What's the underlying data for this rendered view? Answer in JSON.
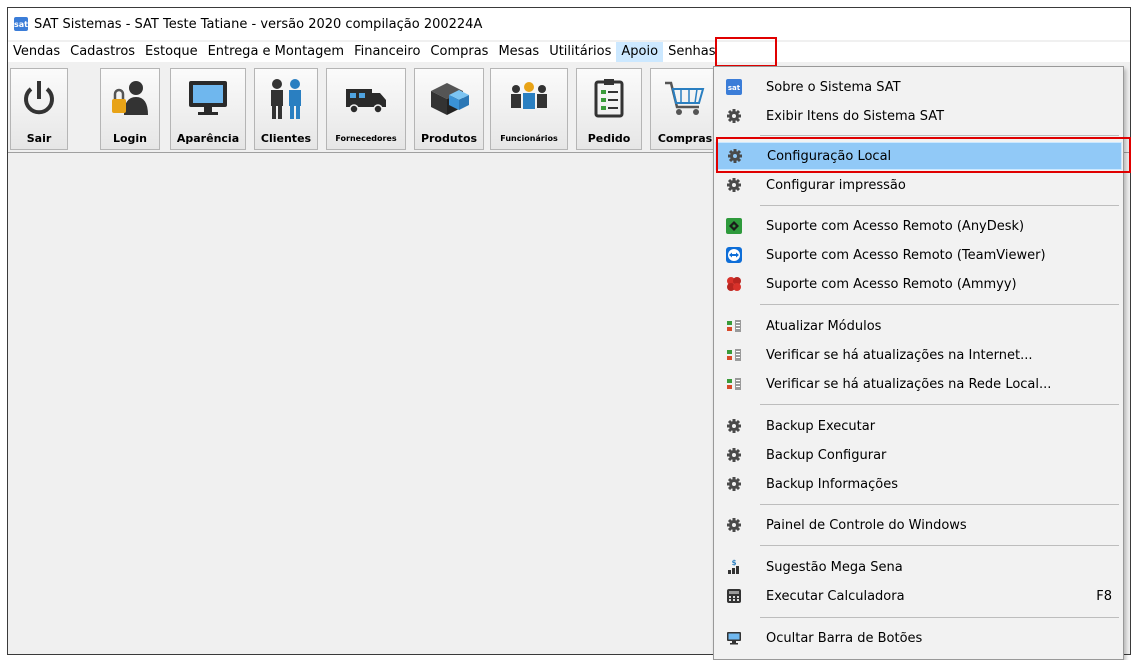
{
  "window": {
    "title": "SAT Sistemas - SAT Teste Tatiane - versão 2020 compilação 200224A",
    "app_icon_text": "sat"
  },
  "menubar": {
    "items": [
      {
        "label": "Vendas"
      },
      {
        "label": "Cadastros"
      },
      {
        "label": "Estoque"
      },
      {
        "label": "Entrega e Montagem"
      },
      {
        "label": "Financeiro"
      },
      {
        "label": "Compras"
      },
      {
        "label": "Mesas"
      },
      {
        "label": "Utilitários"
      },
      {
        "label": "Apoio",
        "active": true
      },
      {
        "label": "Senhas"
      }
    ]
  },
  "toolbar": {
    "buttons": [
      {
        "label": "Sair",
        "icon": "power-icon"
      },
      {
        "label": "Login",
        "icon": "user-lock-icon"
      },
      {
        "label": "Aparência",
        "icon": "monitor-icon"
      },
      {
        "label": "Clientes",
        "icon": "people-icon"
      },
      {
        "label": "Fornecedores",
        "icon": "truck-icon"
      },
      {
        "label": "Produtos",
        "icon": "boxes-icon"
      },
      {
        "label": "Funcionários",
        "icon": "team-icon"
      },
      {
        "label": "Pedido",
        "icon": "checklist-icon"
      },
      {
        "label": "Compras",
        "icon": "cart-icon"
      }
    ]
  },
  "apoio_menu": {
    "items": [
      {
        "label": "Sobre o Sistema SAT",
        "icon": "sat-logo-icon"
      },
      {
        "label": "Exibir Itens do Sistema SAT",
        "icon": "gear-icon"
      },
      {
        "label": "Configuração Local",
        "icon": "gear-icon",
        "selected": true
      },
      {
        "label": "Configurar impressão",
        "icon": "gear-icon"
      },
      {
        "label": "Suporte com Acesso Remoto (AnyDesk)",
        "icon": "anydesk-icon"
      },
      {
        "label": "Suporte com Acesso Remoto (TeamViewer)",
        "icon": "teamviewer-icon"
      },
      {
        "label": "Suporte com Acesso Remoto (Ammyy)",
        "icon": "ammyy-icon"
      },
      {
        "label": "Atualizar Módulos",
        "icon": "update-icon"
      },
      {
        "label": "Verificar se há atualizações na Internet...",
        "icon": "update-icon"
      },
      {
        "label": "Verificar se há atualizações na Rede Local...",
        "icon": "update-icon"
      },
      {
        "label": "Backup Executar",
        "icon": "gear-icon"
      },
      {
        "label": "Backup Configurar",
        "icon": "gear-icon"
      },
      {
        "label": "Backup Informações",
        "icon": "gear-icon"
      },
      {
        "label": "Painel de Controle do Windows",
        "icon": "gear-icon"
      },
      {
        "label": "Sugestão Mega Sena",
        "icon": "dollar-chart-icon"
      },
      {
        "label": "Executar Calculadora",
        "icon": "calculator-icon",
        "shortcut": "F8"
      },
      {
        "label": "Ocultar Barra de Botões",
        "icon": "monitor-icon"
      }
    ]
  },
  "colors": {
    "highlight_red": "#e00000",
    "selected_bg": "#91c9f7",
    "active_menu_bg": "#cce8ff"
  }
}
